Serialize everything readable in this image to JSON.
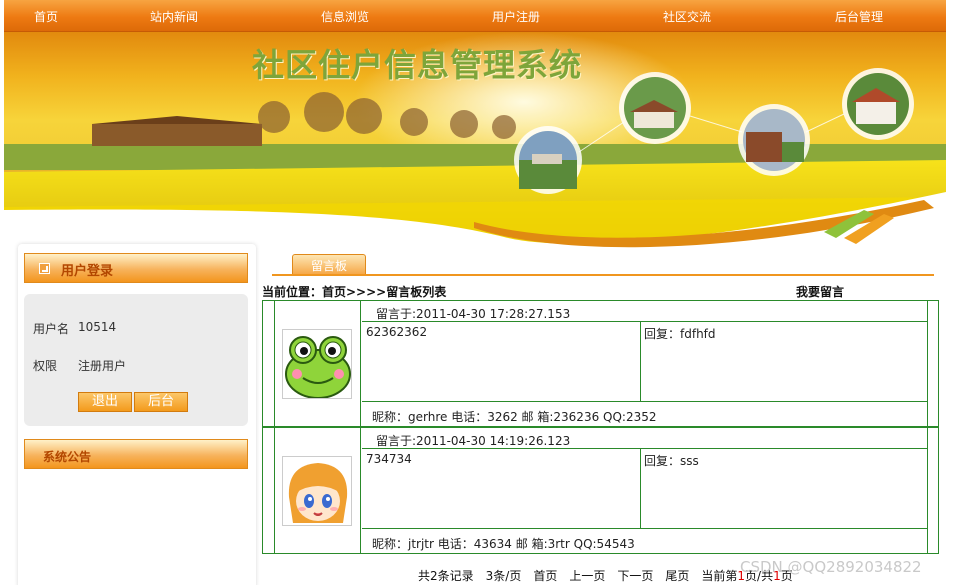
{
  "nav": {
    "items": [
      "首页",
      "站内新闻",
      "信息浏览",
      "用户注册",
      "社区交流",
      "后台管理"
    ]
  },
  "banner": {
    "title": "社区住户信息管理系统"
  },
  "sidebar": {
    "login_title": "用户登录",
    "username_label": "用户名",
    "username_value": "10514",
    "role_label": "权限",
    "role_value": "注册用户",
    "logout_button": "退出",
    "admin_button": "后台",
    "notice_title": "系统公告"
  },
  "main": {
    "tab_label": "留言板",
    "breadcrumb": "当前位置：首页>>>>留言板列表",
    "post_link": "我要留言",
    "messages": [
      {
        "time": "留言于:2011-04-30 17:28:27.153",
        "content": "62362362",
        "reply": "回复：fdfhfd",
        "info": "昵称：gerhre    电话：3262  邮 箱:236236   QQ:2352"
      },
      {
        "time": "留言于:2011-04-30 14:19:26.123",
        "content": "734734",
        "reply": "回复：sss",
        "info": "昵称：jtrjtr    电话：43634  邮 箱:3rtr   QQ:54543"
      }
    ],
    "pager": {
      "total": "共2条记录",
      "per_page": "3条/页",
      "first": "首页",
      "prev": "上一页",
      "next": "下一页",
      "last": "尾页",
      "current_prefix": "当前第",
      "current_page": "1",
      "current_mid": "页/共",
      "total_pages": "1",
      "current_suffix": "页"
    }
  },
  "watermark": "CSDN @QQ2892034822",
  "colors": {
    "nav_orange": "#ee7a12",
    "table_border": "#2a8a2a",
    "title_green": "#7ea53a"
  }
}
